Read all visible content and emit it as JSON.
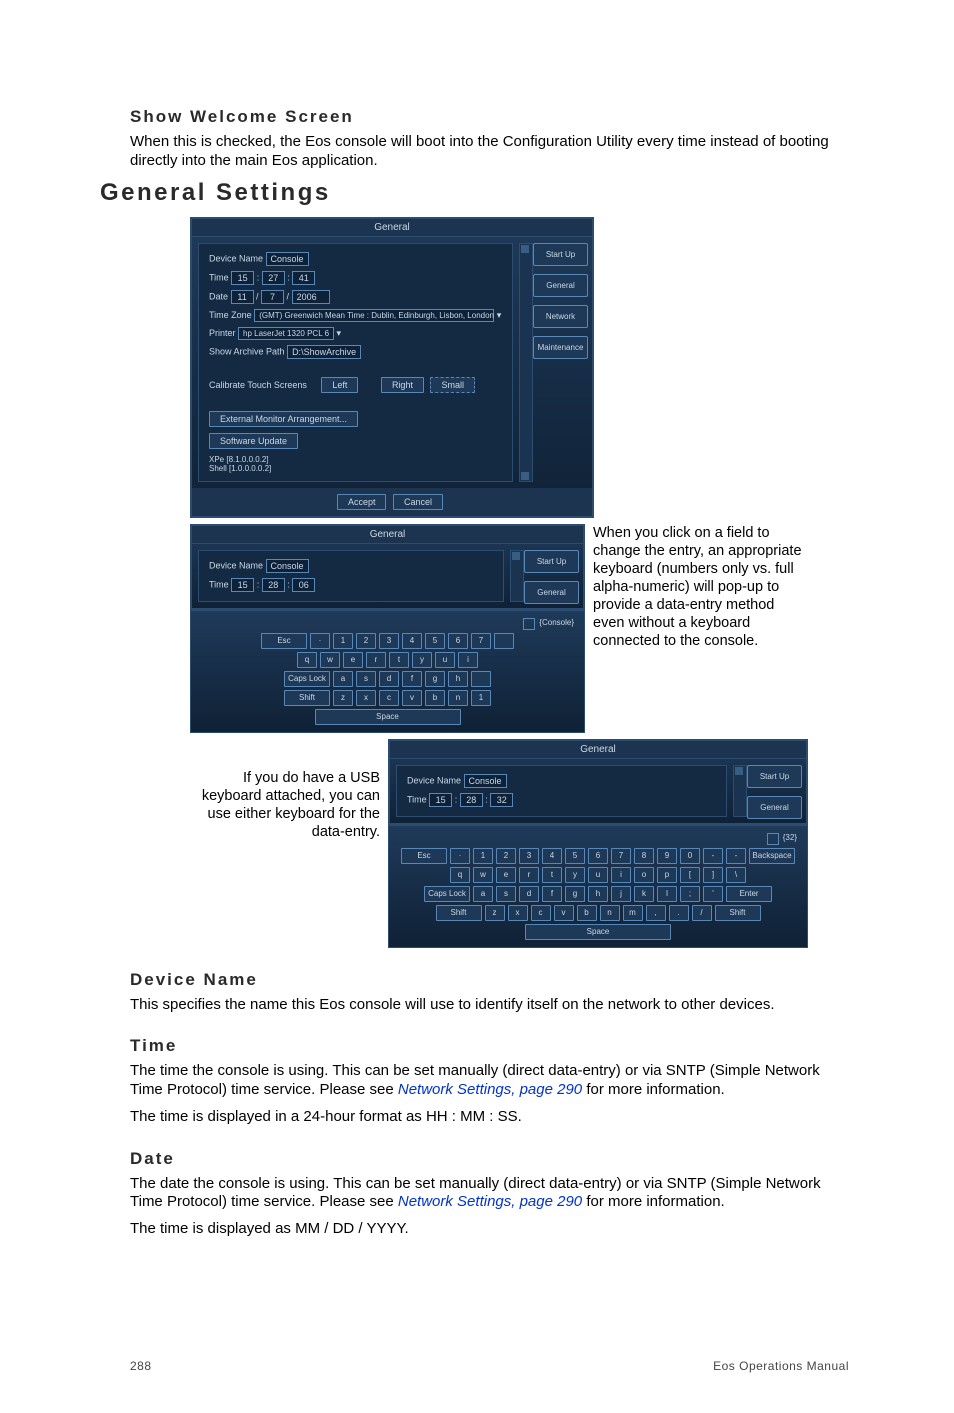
{
  "h_show_welcome": "Show Welcome Screen",
  "p_show_welcome": "When this is checked, the Eos console will boot into the Configuration Utility every time instead of booting directly into the main Eos application.",
  "h_general": "General Settings",
  "h_device": "Device Name",
  "p_device": "This specifies the name this Eos console will use to identify itself on the network to other devices.",
  "h_time": "Time",
  "p_time1a": "The time the console is using. This can be set manually (direct data-entry) or via SNTP (Simple Network Time Protocol) time service. Please see ",
  "p_time_link": "Network Settings, page 290",
  "p_time1b": " for more information.",
  "p_time2": "The time is displayed in a 24-hour format as HH : MM : SS.",
  "h_date": "Date",
  "p_date1a": "The date the console is using. This can be set manually (direct data-entry) or via SNTP (Simple Network Time Protocol) time service. Please see ",
  "p_date_link": "Network Settings, page 290",
  "p_date1b": " for more information.",
  "p_date2": "The time is displayed as MM / DD / YYYY.",
  "caption1": "When you click on a field to change the entry, an appropriate keyboard (numbers only vs. full alpha-numeric) will pop-up to provide a data-entry method even without a keyboard connected to the console.",
  "caption2": "If you do have a USB keyboard attached, you can use either keyboard for the data-entry.",
  "page_num": "288",
  "doc_title": "Eos Operations Manual",
  "shot1": {
    "title": "General",
    "device_label": "Device Name",
    "device_val": "Console",
    "time_label": "Time",
    "time_h": "15",
    "time_m": "27",
    "time_s": "41",
    "date_label": "Date",
    "date_m": "11",
    "date_d": "7",
    "date_y": "2006",
    "tz_label": "Time Zone",
    "tz_val": "(GMT) Greenwich Mean Time : Dublin, Edinburgh, Lisbon, London",
    "printer_label": "Printer",
    "printer_val": "hp LaserJet 1320 PCL 6",
    "archive_label": "Show Archive Path",
    "archive_val": "D:\\ShowArchive",
    "calib_label": "Calibrate Touch Screens",
    "calib_left": "Left",
    "calib_right": "Right",
    "calib_small": "Small",
    "ext_mon": "External Monitor Arrangement...",
    "sw_update": "Software Update",
    "xpe": "XPe [8.1.0.0.0.2]",
    "shell": "Shell [1.0.0.0.0.2]",
    "accept": "Accept",
    "cancel": "Cancel",
    "tabs": [
      "Start Up",
      "General",
      "Network",
      "Maintenance"
    ]
  },
  "shot2": {
    "title": "General",
    "device_label": "Device Name",
    "device_val": "Console",
    "time_label": "Time",
    "time_h": "15",
    "time_m": "28",
    "time_s": "06",
    "tabs": [
      "Start Up",
      "General"
    ],
    "kbd_title": "{Console}",
    "keys_r1": [
      "Esc",
      "·",
      "1",
      "2",
      "3",
      "4",
      "5",
      "6",
      "7",
      ""
    ],
    "keys_r2": [
      "q",
      "w",
      "e",
      "r",
      "t",
      "y",
      "u",
      "i"
    ],
    "keys_r3": [
      "Caps Lock",
      "a",
      "s",
      "d",
      "f",
      "g",
      "h",
      ""
    ],
    "keys_r4": [
      "Shift",
      "z",
      "x",
      "c",
      "v",
      "b",
      "n",
      "1"
    ],
    "space": "Space"
  },
  "shot3": {
    "title": "General",
    "device_label": "Device Name",
    "device_val": "Console",
    "time_label": "Time",
    "time_h": "15",
    "time_m": "28",
    "time_s": "32",
    "tabs": [
      "Start Up",
      "General"
    ],
    "kbd_title": "{32}",
    "keys_r1": [
      "Esc",
      "·",
      "1",
      "2",
      "3",
      "4",
      "5",
      "6",
      "7",
      "8",
      "9",
      "0",
      "-",
      "-",
      "Backspace"
    ],
    "keys_r2": [
      "q",
      "w",
      "e",
      "r",
      "t",
      "y",
      "u",
      "i",
      "o",
      "p",
      "[",
      "]",
      "\\"
    ],
    "keys_r3": [
      "Caps Lock",
      "a",
      "s",
      "d",
      "f",
      "g",
      "h",
      "j",
      "k",
      "l",
      ";",
      "'",
      "Enter"
    ],
    "keys_r4": [
      "Shift",
      "z",
      "x",
      "c",
      "v",
      "b",
      "n",
      "m",
      ",",
      ".",
      "/",
      "Shift"
    ],
    "space": "Space"
  }
}
